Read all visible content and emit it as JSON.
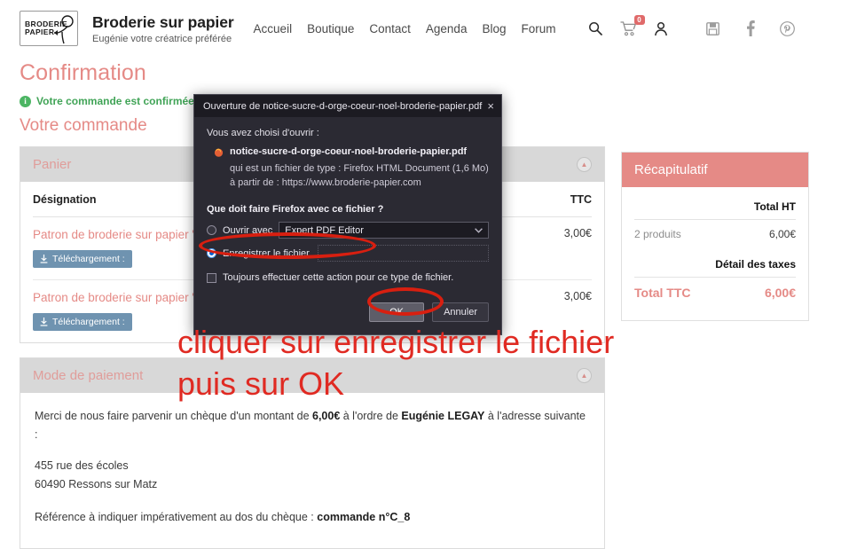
{
  "header": {
    "logo_line1": "BRODERIE",
    "logo_line2": "PAPIER",
    "brand_title": "Broderie sur papier",
    "brand_subtitle": "Eugénie votre créatrice préférée",
    "nav": [
      {
        "label": "Accueil"
      },
      {
        "label": "Boutique"
      },
      {
        "label": "Contact"
      },
      {
        "label": "Agenda"
      },
      {
        "label": "Blog"
      },
      {
        "label": "Forum"
      }
    ],
    "icons": [
      {
        "name": "search-icon"
      },
      {
        "name": "cart-icon",
        "badge": "0"
      },
      {
        "name": "account-icon"
      },
      {
        "name": "save-icon"
      },
      {
        "name": "facebook-icon"
      },
      {
        "name": "pinterest-icon"
      }
    ],
    "cart_badge": "0"
  },
  "page": {
    "title": "Confirmation",
    "confirmation_notice": "Votre commande est confirmée",
    "section_title": "Votre commande"
  },
  "cart_panel": {
    "title": "Panier",
    "columns": [
      "Désignation",
      "TTC"
    ],
    "rows": [
      {
        "name": "Patron de broderie sur papier \"carte numérique, PDF à télécharger",
        "download_label": "Téléchargement :",
        "price": "3,00€"
      },
      {
        "name": "Patron de broderie sur papier \"carte numérique, PDF à télécharger",
        "download_label": "Téléchargement :",
        "price": "3,00€"
      }
    ]
  },
  "recap": {
    "title": "Récapitulatif",
    "total_ht_label": "Total HT",
    "products_label": "2 produits",
    "products_amount": "6,00€",
    "taxes_label": "Détail des taxes",
    "total_ttc_label": "Total TTC",
    "total_ttc_amount": "6,00€"
  },
  "payment_panel": {
    "title": "Mode de paiement",
    "intro_pre": "Merci de nous faire parvenir un chèque d'un montant de ",
    "amount": "6,00€",
    "intro_mid": " à l'ordre de ",
    "payee": "Eugénie LEGAY",
    "intro_post": " à l'adresse suivante :",
    "address_line1": "455 rue des écoles",
    "address_line2": "60490 Ressons sur Matz",
    "reference_pre": "Référence à indiquer impérativement au dos du chèque : ",
    "reference_value": "commande n°C_8"
  },
  "firefox_dialog": {
    "titlebar": "Ouverture de notice-sucre-d-orge-coeur-noel-broderie-papier.pdf",
    "close_icon": "×",
    "lead": "Vous avez choisi d'ouvrir :",
    "file_name": "notice-sucre-d-orge-coeur-noel-broderie-papier.pdf",
    "file_type_line": "qui est un fichier de type : Firefox HTML Document (1,6 Mo)",
    "file_source_line": "à partir de : https://www.broderie-papier.com",
    "question": "Que doit faire Firefox avec ce fichier ?",
    "option_open_label": "Ouvrir avec",
    "option_open_app": "Expert PDF Editor",
    "option_save_label": "Enregistrer le fichier",
    "checkbox_label": "Toujours effectuer cette action pour ce type de fichier.",
    "ok_label": "OK",
    "cancel_label": "Annuler",
    "selected_option": "Enregistrer le fichier"
  },
  "annotations": {
    "line1": "cliquer sur enregistrer le fichier",
    "line2": "puis sur OK",
    "color": "#e02a22"
  }
}
